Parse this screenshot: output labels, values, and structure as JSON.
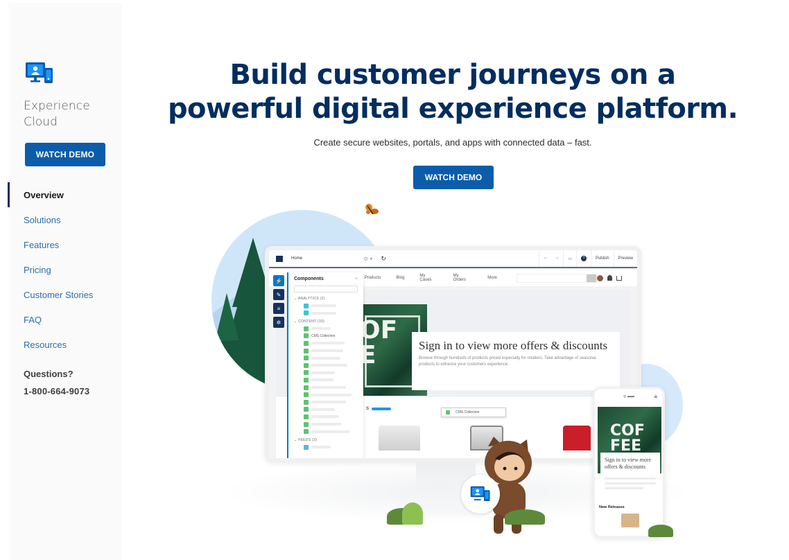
{
  "sidebar": {
    "logo_icon": "experience-cloud-icon",
    "product_name_line1": "Experience",
    "product_name_line2": "Cloud",
    "watch_demo_label": "WATCH DEMO",
    "nav": [
      {
        "label": "Overview",
        "active": true
      },
      {
        "label": "Solutions",
        "active": false
      },
      {
        "label": "Features",
        "active": false
      },
      {
        "label": "Pricing",
        "active": false
      },
      {
        "label": "Customer Stories",
        "active": false
      },
      {
        "label": "FAQ",
        "active": false
      },
      {
        "label": "Resources",
        "active": false
      }
    ],
    "questions_label": "Questions?",
    "phone": "1-800-664-9073"
  },
  "hero": {
    "title_line1": "Build customer journeys on a",
    "title_line2": "powerful digital experience platform.",
    "subtitle": "Create secure websites, portals, and apps with connected data – fast.",
    "watch_demo_label": "WATCH DEMO"
  },
  "illustration": {
    "builder": {
      "page_name": "Home",
      "publish_label": "Publish",
      "preview_label": "Preview",
      "site_nav": [
        "Products",
        "Blog",
        "My Cases",
        "My Orders",
        "More"
      ],
      "components_title": "Components",
      "close_glyph": "×",
      "sections": [
        {
          "label": "ANALYTICS (2)"
        },
        {
          "label": "CONTENT (15)"
        },
        {
          "label": "FEEDS (3)"
        }
      ],
      "cms_collection_label": "CMS Collection",
      "banner_heading": "Sign in to view more offers & discounts",
      "banner_body": "Browse through hundreds of products priced especially for retailers. Take advantage of seasonal products to enhance your customers experience.",
      "banner_letters_line1": "OF",
      "banner_letters_line2": "E",
      "products_fragment": "s"
    },
    "phone": {
      "coffee_line1": "COF",
      "coffee_line2": "FEE",
      "card_heading": "Sign in to view more offers & discounts",
      "new_releases_label": "New Releases",
      "menu_glyph": "≡"
    }
  },
  "colors": {
    "brand_blue": "#0b5cab",
    "title_navy": "#032d60",
    "nav_link": "#2e6ea8"
  }
}
